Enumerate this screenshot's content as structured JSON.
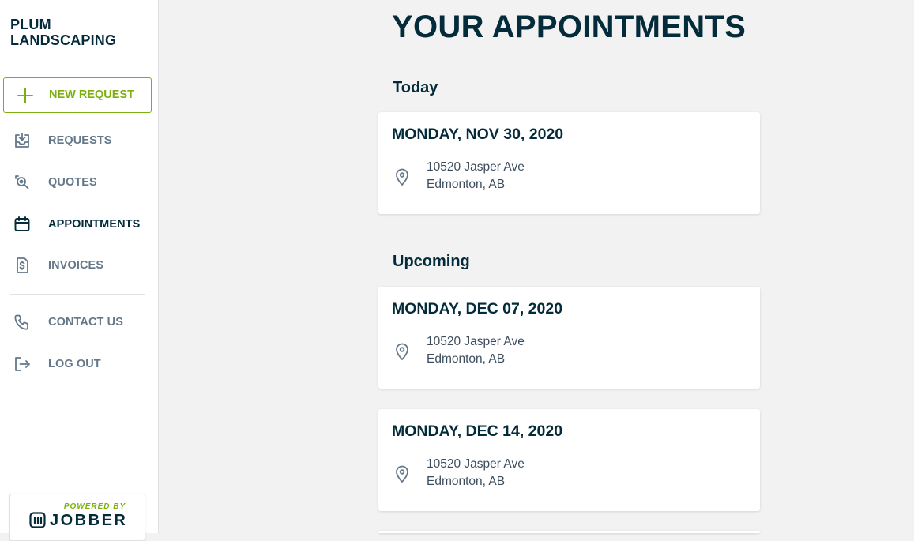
{
  "brand": {
    "line1": "PLUM",
    "line2": "LANDSCAPING"
  },
  "sidebar": {
    "new_request_label": "NEW REQUEST",
    "items": [
      {
        "label": "REQUESTS",
        "icon": "inbox-download-icon"
      },
      {
        "label": "QUOTES",
        "icon": "quote-magnifier-icon"
      },
      {
        "label": "APPOINTMENTS",
        "icon": "calendar-icon",
        "active": true
      },
      {
        "label": "INVOICES",
        "icon": "invoice-dollar-icon"
      },
      {
        "label": "CONTACT US",
        "icon": "phone-icon"
      },
      {
        "label": "LOG OUT",
        "icon": "logout-icon"
      }
    ]
  },
  "powered_by": {
    "small": "POWERED BY",
    "name": "JOBBER"
  },
  "main": {
    "title": "YOUR APPOINTMENTS",
    "today_heading": "Today",
    "upcoming_heading": "Upcoming",
    "appointments": [
      {
        "date": "MONDAY, NOV 30, 2020",
        "address_line1": "10520 Jasper Ave",
        "address_line2": "Edmonton, AB"
      },
      {
        "date": "MONDAY, DEC 07, 2020",
        "address_line1": "10520 Jasper Ave",
        "address_line2": "Edmonton, AB"
      },
      {
        "date": "MONDAY, DEC 14, 2020",
        "address_line1": "10520 Jasper Ave",
        "address_line2": "Edmonton, AB"
      }
    ]
  },
  "colors": {
    "accent_green": "#7db00e",
    "text_dark": "#032b3a",
    "nav_gray": "#65788a",
    "background": "#f2f2f3"
  }
}
